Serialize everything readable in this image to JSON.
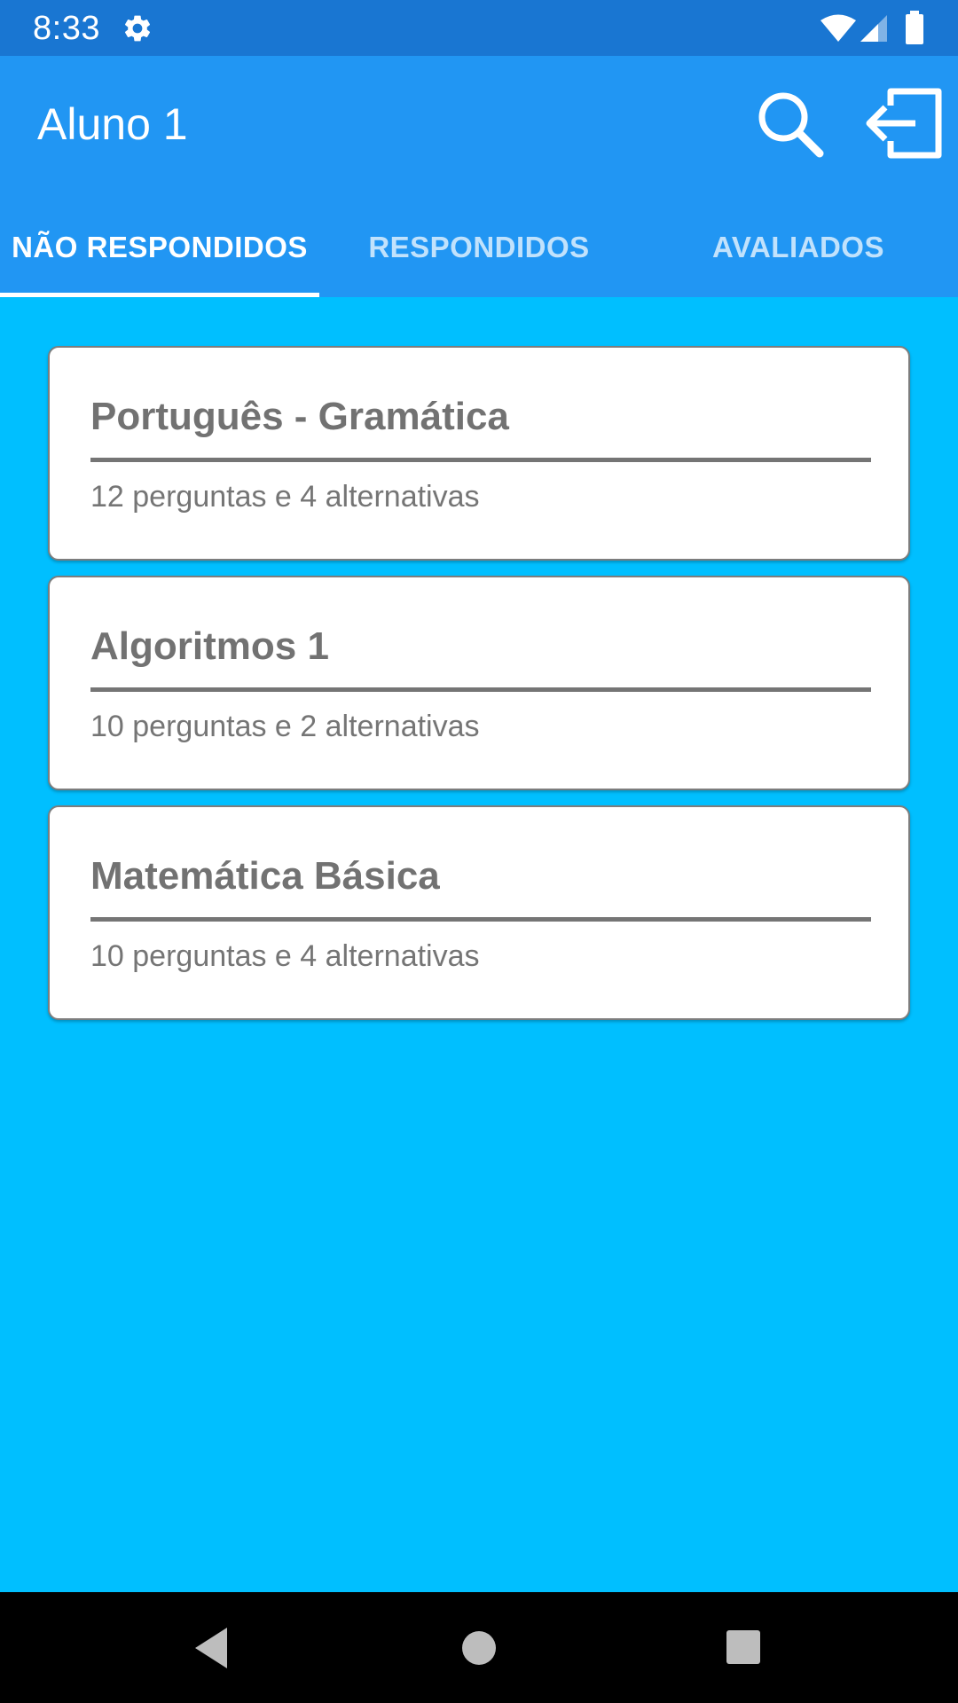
{
  "status_bar": {
    "time": "8:33",
    "icons": [
      "gear-icon",
      "wifi-icon",
      "signal-icon",
      "battery-icon"
    ]
  },
  "app_bar": {
    "title": "Aluno 1",
    "actions": [
      "search-icon",
      "logout-icon"
    ],
    "color": "#2196F3"
  },
  "tabs": [
    {
      "label": "NÃO RESPONDIDOS",
      "active": true
    },
    {
      "label": "RESPONDIDOS",
      "active": false
    },
    {
      "label": "AVALIADOS",
      "active": false
    }
  ],
  "quizzes": [
    {
      "title": "Português - Gramática",
      "subtitle": "12 perguntas e 4 alternativas"
    },
    {
      "title": "Algoritmos 1",
      "subtitle": "10 perguntas e 2 alternativas"
    },
    {
      "title": "Matemática Básica",
      "subtitle": "10 perguntas e 4 alternativas"
    }
  ],
  "nav_bar": {
    "buttons": [
      "back-icon",
      "home-icon",
      "recents-icon"
    ]
  },
  "colors": {
    "status_bar": "#1976D2",
    "background": "#00BFFF",
    "card": "#FFFFFF",
    "card_text": "#727272"
  }
}
